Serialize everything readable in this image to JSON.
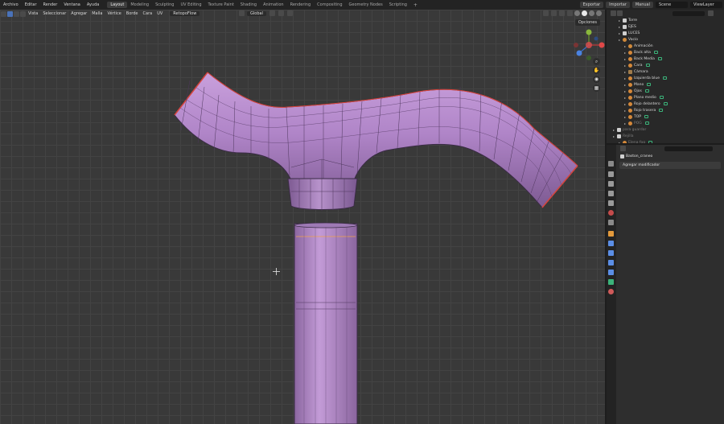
{
  "topbar": {
    "menus": [
      "Archivo",
      "Editar",
      "Render",
      "Ventana",
      "Ayuda"
    ],
    "tabs": [
      "Layout",
      "Modeling",
      "Sculpting",
      "UV Editing",
      "Texture Paint",
      "Shading",
      "Animation",
      "Rendering",
      "Compositing",
      "Geometry Nodes",
      "Scripting"
    ],
    "active_tab": "Layout",
    "add_tab": "+",
    "export_label": "Exportar",
    "import_label": "Importar",
    "manual_label": "Manual",
    "scene_label": "Scene",
    "viewlayer_label": "ViewLayer"
  },
  "viewport": {
    "menus": [
      "Vista",
      "Seleccionar",
      "Agregar",
      "Malla",
      "Vértice",
      "Borde",
      "Cara",
      "UV"
    ],
    "retopoflow_label": "RetopoFlow",
    "orientation_label": "Global",
    "options_label": "Opciones"
  },
  "outliner": {
    "rows": [
      {
        "label": "Torre",
        "indent": 1,
        "icon": "collection",
        "dim": false
      },
      {
        "label": "EJES",
        "indent": 1,
        "icon": "collection",
        "dim": false
      },
      {
        "label": "LUCES",
        "indent": 1,
        "icon": "collection",
        "dim": false
      },
      {
        "label": "Vacío",
        "indent": 1,
        "icon": "empty",
        "dim": false
      },
      {
        "label": "Animación",
        "indent": 2,
        "icon": "empty",
        "dim": false
      },
      {
        "label": "Back alta",
        "indent": 2,
        "icon": "light",
        "dim": false
      },
      {
        "label": "Back Media",
        "indent": 2,
        "icon": "light",
        "dim": false
      },
      {
        "label": "Cara",
        "indent": 2,
        "icon": "light",
        "dim": false
      },
      {
        "label": "Cámara",
        "indent": 2,
        "icon": "camera",
        "dim": false
      },
      {
        "label": "Izquierda blue",
        "indent": 2,
        "icon": "light",
        "dim": false
      },
      {
        "label": "Mano",
        "indent": 2,
        "icon": "light",
        "dim": false
      },
      {
        "label": "Ojos",
        "indent": 2,
        "icon": "light",
        "dim": false
      },
      {
        "label": "Plano medio",
        "indent": 2,
        "icon": "light",
        "dim": false
      },
      {
        "label": "Rojo delantero",
        "indent": 2,
        "icon": "light",
        "dim": false
      },
      {
        "label": "Rojo trasera",
        "indent": 2,
        "icon": "light",
        "dim": false
      },
      {
        "label": "TOP",
        "indent": 2,
        "icon": "light",
        "dim": false
      },
      {
        "label": "POG",
        "indent": 2,
        "icon": "light",
        "dim": true
      },
      {
        "label": "para guardar",
        "indent": 0,
        "icon": "collection",
        "dim": true
      },
      {
        "label": "Rejilla",
        "indent": 0,
        "icon": "collection",
        "dim": true
      },
      {
        "label": "Elena fog",
        "indent": 1,
        "icon": "light",
        "dim": true
      }
    ]
  },
  "properties": {
    "object_name": "Baston_craneo",
    "add_modifier_label": "Agregar modificador"
  },
  "colors": {
    "mesh": "#b184c8",
    "mesh_dark": "#6a4a7e",
    "seam": "#e0453a",
    "viewport_bg": "#393939",
    "accent": "#4a72b8"
  }
}
